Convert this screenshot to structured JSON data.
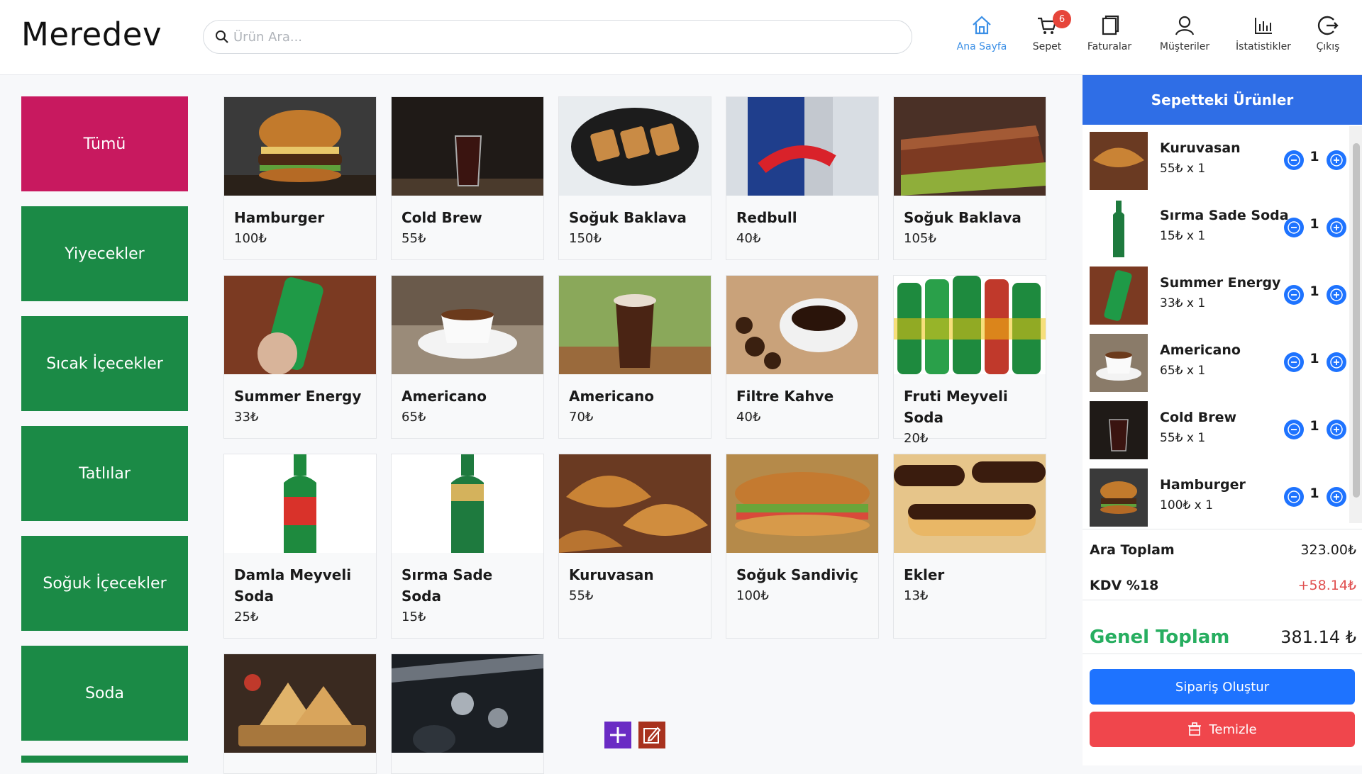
{
  "app": {
    "logo": "Meredev"
  },
  "search": {
    "placeholder": "Ürün Ara..."
  },
  "nav": {
    "home": "Ana Sayfa",
    "cart": "Sepet",
    "cart_count": "6",
    "invoices": "Faturalar",
    "customers": "Müşteriler",
    "stats": "İstatistikler",
    "logout": "Çıkış"
  },
  "categories": [
    "Tümü",
    "Yiyecekler",
    "Sıcak İçecekler",
    "Tatlılar",
    "Soğuk İçecekler",
    "Soda"
  ],
  "products": [
    {
      "name": "Hamburger",
      "price": "100₺",
      "image": "burger"
    },
    {
      "name": "Cold Brew",
      "price": "55₺",
      "image": "cold-brew-glass"
    },
    {
      "name": "Soğuk Baklava",
      "price": "150₺",
      "image": "baklava-plate"
    },
    {
      "name": "Redbull",
      "price": "40₺",
      "image": "redbull-can"
    },
    {
      "name": "Soğuk Baklava",
      "price": "105₺",
      "image": "baklava-slice"
    },
    {
      "name": "Summer Energy",
      "price": "33₺",
      "image": "green-energy-can"
    },
    {
      "name": "Americano",
      "price": "65₺",
      "image": "coffee-cup"
    },
    {
      "name": "Americano",
      "price": "70₺",
      "image": "iced-coffee"
    },
    {
      "name": "Filtre Kahve",
      "price": "40₺",
      "image": "filter-coffee"
    },
    {
      "name": "Fruti Meyveli Soda",
      "price": "20₺",
      "image": "fruti-bottles"
    },
    {
      "name": "Damla Meyveli Soda",
      "price": "25₺",
      "image": "damla-bottle"
    },
    {
      "name": "Sırma Sade Soda",
      "price": "15₺",
      "image": "sirma-bottle"
    },
    {
      "name": "Kuruvasan",
      "price": "55₺",
      "image": "croissants"
    },
    {
      "name": "Soğuk Sandiviç",
      "price": "100₺",
      "image": "sandwich"
    },
    {
      "name": "Ekler",
      "price": "13₺",
      "image": "eclairs"
    },
    {
      "name": "",
      "price": "",
      "image": "club-sandwich"
    },
    {
      "name": "",
      "price": "",
      "image": "party-crowd"
    }
  ],
  "cart": {
    "title": "Sepetteki Ürünler",
    "items": [
      {
        "name": "Kuruvasan",
        "detail": "55₺ x 1",
        "qty": "1",
        "image": "croissants"
      },
      {
        "name": "Sırma Sade Soda",
        "detail": "15₺ x 1",
        "qty": "1",
        "image": "sirma-bottle"
      },
      {
        "name": "Summer Energy",
        "detail": "33₺ x 1",
        "qty": "1",
        "image": "green-energy-can"
      },
      {
        "name": "Americano",
        "detail": "65₺ x 1",
        "qty": "1",
        "image": "coffee-cup"
      },
      {
        "name": "Cold Brew",
        "detail": "55₺ x 1",
        "qty": "1",
        "image": "cold-brew-glass"
      },
      {
        "name": "Hamburger",
        "detail": "100₺ x 1",
        "qty": "1",
        "image": "burger"
      }
    ],
    "subtotal_label": "Ara Toplam",
    "subtotal": "323.00₺",
    "vat_label": "KDV %18",
    "vat": "+58.14₺",
    "total_label": "Genel Toplam",
    "total": "381.14 ₺",
    "order_button": "Sipariş Oluştur",
    "clear_button": "Temizle"
  },
  "colors": {
    "accent": "#2f6ee6",
    "category_active": "#c8195f",
    "category": "#1b8a46",
    "total_green": "#27ae60",
    "danger": "#f0464c",
    "vat_red": "#e05050"
  }
}
